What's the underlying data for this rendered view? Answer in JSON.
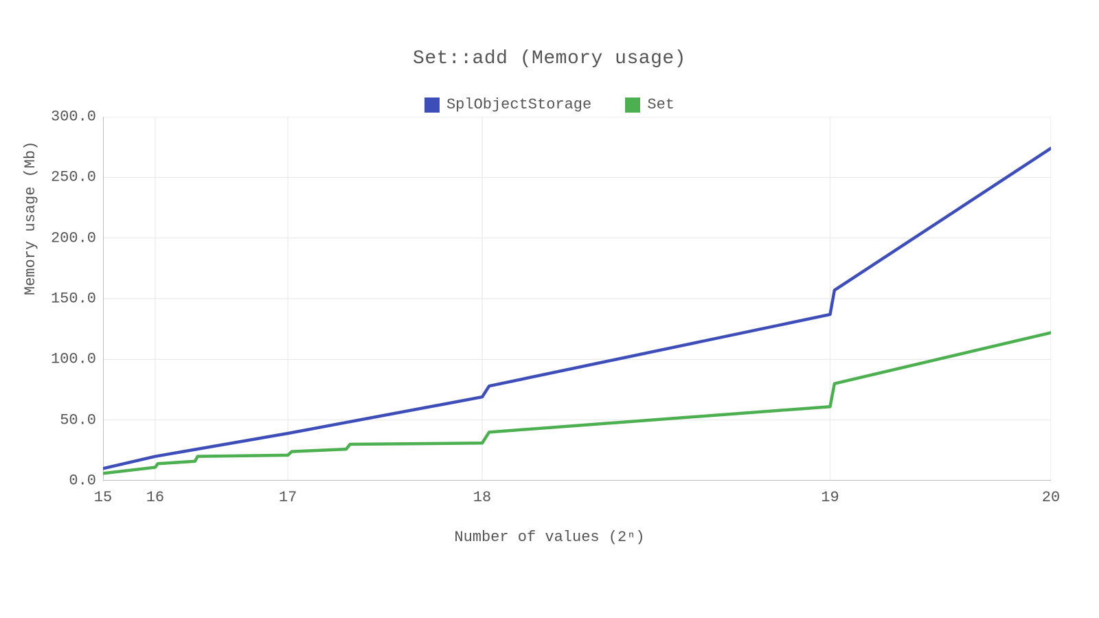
{
  "chart_data": {
    "type": "line",
    "title": "Set::add (Memory usage)",
    "xlabel": "Number of values (2ⁿ)",
    "ylabel": "Memory usage (Mb)",
    "xlim": [
      15,
      20
    ],
    "ylim": [
      0,
      300
    ],
    "x_ticks": [
      15,
      16,
      17,
      18,
      19,
      20
    ],
    "y_ticks": [
      0,
      50,
      100,
      150,
      200,
      250,
      300
    ],
    "y_tick_labels": [
      "0.0",
      "50.0",
      "100.0",
      "150.0",
      "200.0",
      "250.0",
      "300.0"
    ],
    "legend_position": "top",
    "grid": true,
    "series": [
      {
        "name": "SplObjectStorage",
        "color": "#3E4EB8",
        "points": [
          [
            15.0,
            10
          ],
          [
            16.0,
            20
          ],
          [
            17.0,
            39
          ],
          [
            18.0,
            69
          ],
          [
            18.02,
            78
          ],
          [
            19.0,
            137
          ],
          [
            19.02,
            157
          ],
          [
            20.0,
            274
          ]
        ]
      },
      {
        "name": "Set",
        "color": "#4CAF50",
        "points": [
          [
            15.0,
            6
          ],
          [
            16.0,
            11
          ],
          [
            16.02,
            14
          ],
          [
            16.3,
            16
          ],
          [
            16.32,
            20
          ],
          [
            17.0,
            21
          ],
          [
            17.02,
            24
          ],
          [
            17.3,
            26
          ],
          [
            17.32,
            30
          ],
          [
            18.0,
            31
          ],
          [
            18.02,
            40
          ],
          [
            19.0,
            61
          ],
          [
            19.02,
            80
          ],
          [
            20.0,
            122
          ]
        ]
      }
    ]
  }
}
